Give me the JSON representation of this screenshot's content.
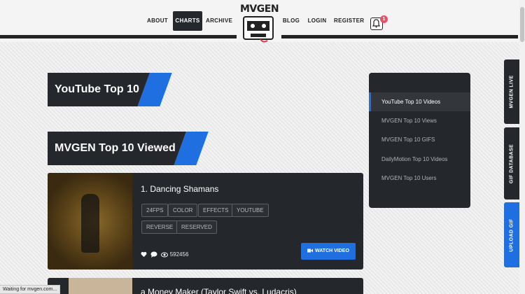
{
  "nav": {
    "about": "ABOUT",
    "charts": "CHARTS",
    "archive": "ARCHIVE",
    "blog": "BLOG",
    "login": "LOGIN",
    "register": "REGISTER"
  },
  "logo": {
    "text": "MVGEN"
  },
  "notifications": {
    "count": "1"
  },
  "sections": {
    "youtube_title": "YouTube Top 10",
    "mvgen_title": "MVGEN Top 10 Viewed"
  },
  "video": {
    "title": "1. Dancing Shamans",
    "tags": [
      "24FPS",
      "COLOR",
      "EFFECTS",
      "YOUTUBE",
      "REVERSE",
      "RESERVED"
    ],
    "views": "592456",
    "watch_label": "WATCH VIDEO"
  },
  "video2": {
    "title": "a Money Maker (Taylor Swift vs. Ludacris)"
  },
  "sidemenu": {
    "items": [
      "YouTube Top 10 Videos",
      "MVGEN Top 10 Views",
      "MVGEN Top 10 GIFS",
      "DailyMotion Top 10 Videos",
      "MVGEN Top 10 Users"
    ],
    "active_index": 0
  },
  "side_tabs": {
    "live": "MVGEN LIVE",
    "gif_db": "GIF DATABASE",
    "upload": "UPLOAD GIF"
  },
  "status": {
    "text": "Waiting for mvgen.com..."
  },
  "colors": {
    "accent": "#1f6fe0",
    "dark": "#24272b",
    "badge": "#e8516a"
  }
}
